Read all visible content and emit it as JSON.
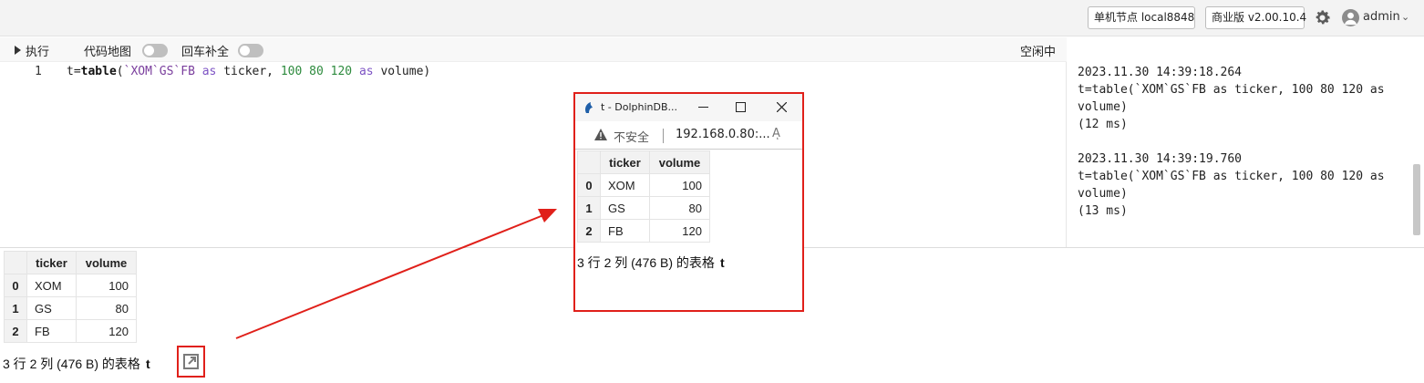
{
  "header": {
    "node_label": "单机节点 local8848",
    "edition_label": "商业版 v2.00.10.4",
    "username": "admin"
  },
  "toolbar": {
    "run_label": "执行",
    "code_map_label": "代码地图",
    "autocomplete_label": "回车补全",
    "status": "空闲中"
  },
  "editor": {
    "line_number": "1",
    "tokens": {
      "t_assign": "t=",
      "fn": "table",
      "open": "(",
      "syms": "`XOM`GS`FB",
      "as1": "as",
      "ticker": "ticker,",
      "n1": "100",
      "n2": "80",
      "n3": "120",
      "as2": "as",
      "volume": "volume)"
    }
  },
  "log": {
    "entries": [
      {
        "time": "2023.11.30 14:39:18.264",
        "code_line1": "t=table(`XOM`GS`FB as ticker, 100 80 120 as",
        "code_line2": "volume)",
        "duration": "(12 ms)"
      },
      {
        "time": "2023.11.30 14:39:19.760",
        "code_line1": "t=table(`XOM`GS`FB as ticker, 100 80 120 as",
        "code_line2": "volume)",
        "duration": "(13 ms)"
      }
    ]
  },
  "result": {
    "columns": [
      "ticker",
      "volume"
    ],
    "rows": [
      {
        "index": "0",
        "ticker": "XOM",
        "volume": "100"
      },
      {
        "index": "1",
        "ticker": "GS",
        "volume": "80"
      },
      {
        "index": "2",
        "ticker": "FB",
        "volume": "120"
      }
    ],
    "summary_text": "3 行 2 列 (476 B) 的表格",
    "table_name": "t"
  },
  "popup": {
    "title": "t - DolphinDB...",
    "insecure_label": "不安全",
    "url": "192.168.0.80:...",
    "read_aloud_icon": "Aͅ",
    "columns": [
      "ticker",
      "volume"
    ],
    "rows": [
      {
        "index": "0",
        "ticker": "XOM",
        "volume": "100"
      },
      {
        "index": "1",
        "ticker": "GS",
        "volume": "80"
      },
      {
        "index": "2",
        "ticker": "FB",
        "volume": "120"
      }
    ],
    "summary_text": "3 行 2 列 (476 B) 的表格",
    "table_name": "t"
  },
  "colors": {
    "highlight_red": "#e0201a",
    "keyword_purple": "#7d53c4",
    "number_green": "#2e8b3e"
  },
  "icons": [
    "gear-icon",
    "avatar-icon",
    "chevron-down-icon",
    "play-icon",
    "open-in-new-window-icon",
    "dolphindb-logo-icon",
    "minimize-icon",
    "maximize-icon",
    "close-icon",
    "warning-icon",
    "read-aloud-icon"
  ]
}
